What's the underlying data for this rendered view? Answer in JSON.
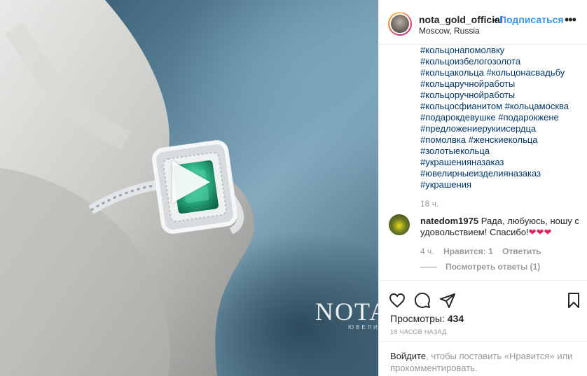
{
  "post": {
    "username": "nota_gold_official",
    "separator": "•",
    "follow_label": "Подписаться",
    "location": "Moscow, Russia",
    "more_label": "•••"
  },
  "media": {
    "watermark": "NOTA",
    "watermark_sub": "ЮВЕЛИР"
  },
  "caption": {
    "hashtags": [
      "#кольцонапомолвку",
      "#кольцоизбелогозолота",
      "#кольцакольца #кольцонасвадьбу",
      "#кольцаручнойработы",
      "#кольцоручнойработы",
      "#кольцосфианитом #кольцамосква",
      "#подарокдевушке #подарокжене",
      "#предложениерукиисердца",
      "#помолвка #женскиекольца",
      "#золотыекольца",
      "#украшенияназаказ",
      "#ювелирныеизделияназаказ",
      "#украшения"
    ],
    "time": "18 ч."
  },
  "comment": {
    "username": "natedom1975",
    "text": " Рада, любуюсь, ношу с удовольствием! Спасибо!",
    "hearts": "❤❤❤",
    "time": "4 ч.",
    "likes": "Нравится: 1",
    "reply": "Ответить",
    "view_replies": "Посмотреть ответы (1)"
  },
  "actions": {
    "views_label": "Просмотры:",
    "views_count": "434",
    "date": "18 ЧАСОВ НАЗАД"
  },
  "login": {
    "link": "Войдите",
    "text": ", чтобы поставить «Нравится» или прокомментировать."
  },
  "icons": [
    "heart-icon",
    "comment-icon",
    "share-icon",
    "bookmark-icon",
    "play-icon",
    "more-icon"
  ]
}
